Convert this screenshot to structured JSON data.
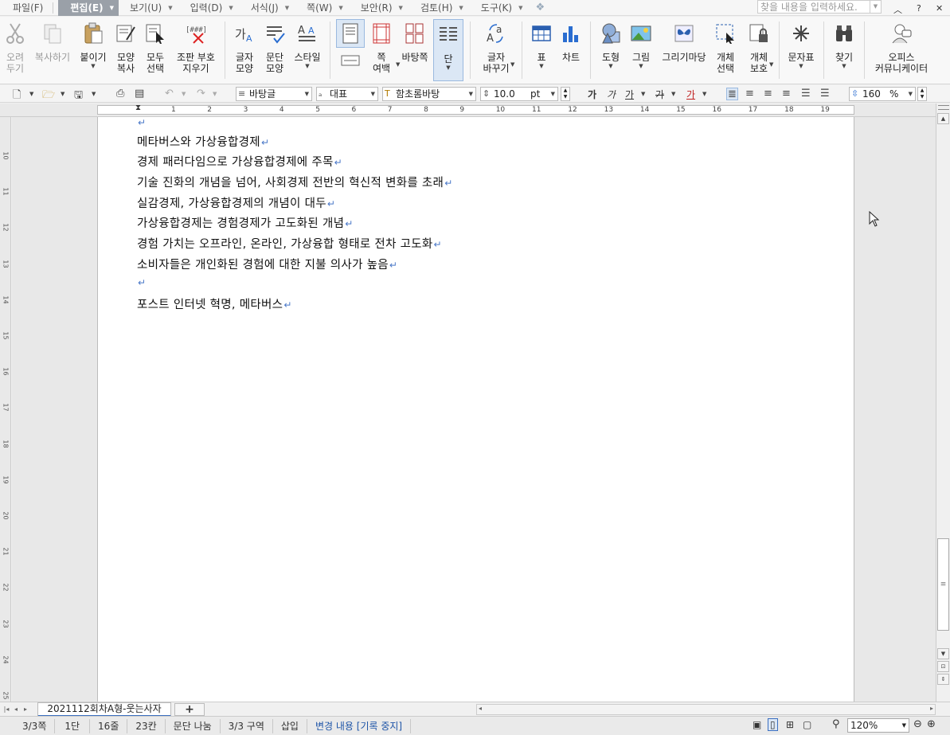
{
  "menubar": {
    "items": [
      {
        "label": "파일(F)",
        "active": false
      },
      {
        "label": "편집(E)",
        "active": true
      },
      {
        "label": "보기(U)",
        "active": false
      },
      {
        "label": "입력(D)",
        "active": false
      },
      {
        "label": "서식(J)",
        "active": false
      },
      {
        "label": "쪽(W)",
        "active": false
      },
      {
        "label": "보안(R)",
        "active": false
      },
      {
        "label": "검토(H)",
        "active": false
      },
      {
        "label": "도구(K)",
        "active": false
      }
    ],
    "search_placeholder": "찾을 내용을 입력하세요."
  },
  "ribbon": {
    "cut": "오려\n두기",
    "copy": "복사하기",
    "paste": "붙이기",
    "format_copy": "모양\n복사",
    "select_all": "모두\n선택",
    "clear_marks": "조판 부호\n지우기",
    "char_shape": "글자\n모양",
    "para_shape": "문단\n모양",
    "style": "스타일",
    "page_margin": "쪽\n여백",
    "background_page": "바탕쪽",
    "column": "단",
    "char_replace": "글자\n바꾸기",
    "table": "표",
    "chart": "차트",
    "shape": "도형",
    "picture": "그림",
    "drawing_madang": "그리기마당",
    "object_select": "개체\n선택",
    "object_protect": "개체\n보호",
    "symbol": "문자표",
    "find": "찾기",
    "office_community": "오피스\n커뮤니케이터"
  },
  "toolbar2": {
    "style_value": "바탕글",
    "lang_value": "대표",
    "font_value": "함초롬바탕",
    "size_value": "10.0",
    "size_unit": "pt",
    "char_spacing": "160",
    "char_spacing_unit": "%",
    "fmt_bold": "가",
    "fmt_italic": "가",
    "fmt_underline": "가",
    "fmt_strike": "가",
    "fmt_color": "가"
  },
  "ruler": {
    "h_numbers": [
      "1",
      "2",
      "3",
      "4",
      "5",
      "6",
      "7",
      "8",
      "9",
      "10",
      "11",
      "12",
      "13",
      "14",
      "15",
      "16",
      "17",
      "18",
      "19"
    ],
    "v_numbers": [
      "10",
      "11",
      "12",
      "13",
      "14",
      "15",
      "16",
      "17",
      "18",
      "19",
      "20",
      "21",
      "22",
      "23",
      "24",
      "25"
    ]
  },
  "document": {
    "lines": [
      "",
      "메타버스와 가상융합경제",
      "경제 패러다임으로 가상융합경제에 주목",
      "기술 진화의 개념을 넘어, 사회경제 전반의 혁신적 변화를 초래",
      "실감경제, 가상융합경제의 개념이 대두",
      "가상융합경제는 경험경제가 고도화된 개념",
      "경험 가치는 오프라인, 온라인, 가상융합 형태로 전차 고도화",
      "소비자들은 개인화된 경험에 대한 지불 의사가 높음",
      "",
      "포스트 인터넷 혁명, 메타버스"
    ],
    "paragraph_mark": "↵"
  },
  "tabbar": {
    "doc_tab": "2021112회차A형-웃는사자",
    "add_tab": "+"
  },
  "statusbar": {
    "page": "3/3쪽",
    "column": "1단",
    "line": "16줄",
    "col": "23칸",
    "para_break": "문단 나눔",
    "section": "3/3 구역",
    "insert_mode": "삽입",
    "track_changes": "변경 내용 [기록 중지]",
    "zoom": "120%"
  }
}
